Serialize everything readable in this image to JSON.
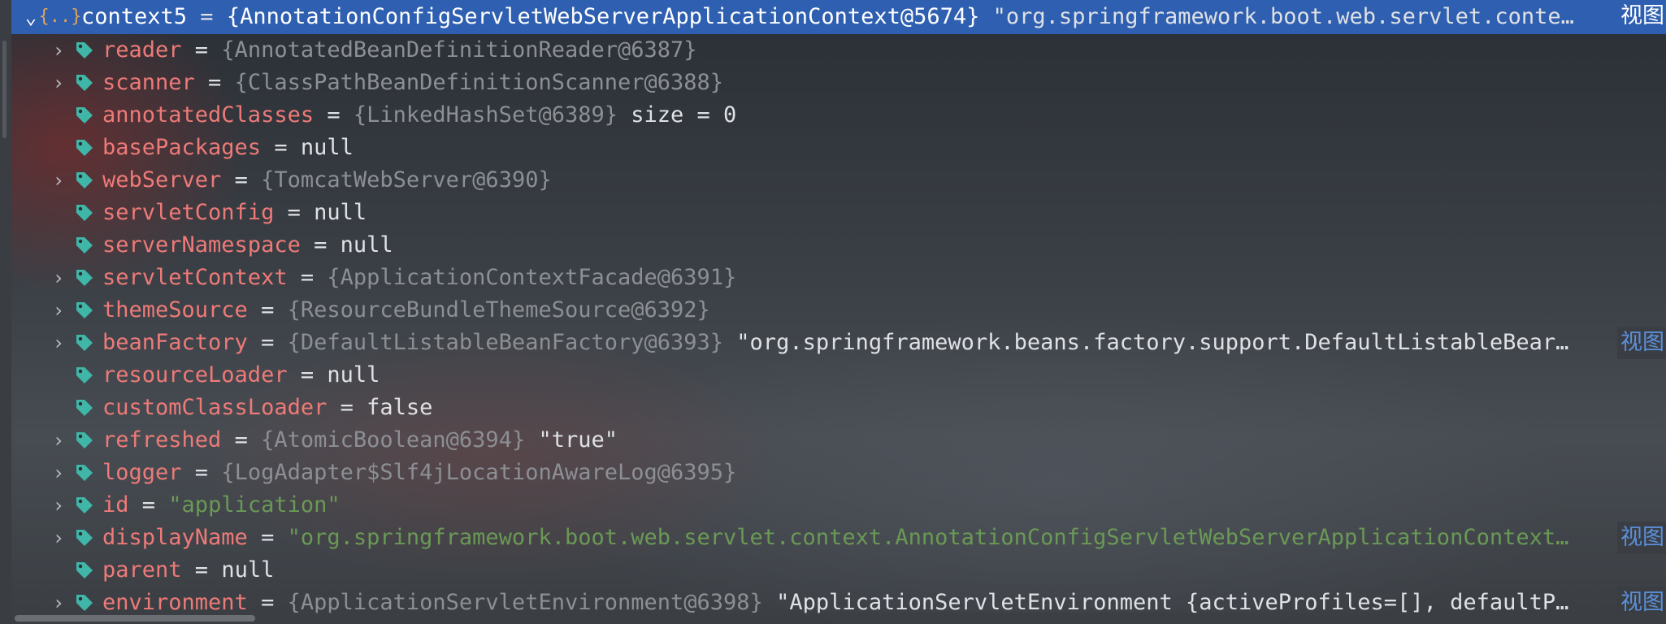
{
  "root": {
    "name": "context5",
    "type": "{AnnotationConfigServletWebServerApplicationContext@5674}",
    "value": "\"org.springframework.boot.web.servlet.conte…",
    "link": "视图"
  },
  "fields": [
    {
      "name": "reader",
      "type": "{AnnotatedBeanDefinitionReader@6387}",
      "expandable": true
    },
    {
      "name": "scanner",
      "type": "{ClassPathBeanDefinitionScanner@6388}",
      "expandable": true
    },
    {
      "name": "annotatedClasses",
      "type": "{LinkedHashSet@6389}",
      "extra": " size = 0",
      "expandable": false
    },
    {
      "name": "basePackages",
      "value": "null",
      "expandable": false
    },
    {
      "name": "webServer",
      "type": "{TomcatWebServer@6390}",
      "expandable": true
    },
    {
      "name": "servletConfig",
      "value": "null",
      "expandable": false
    },
    {
      "name": "serverNamespace",
      "value": "null",
      "expandable": false
    },
    {
      "name": "servletContext",
      "type": "{ApplicationContextFacade@6391}",
      "expandable": true
    },
    {
      "name": "themeSource",
      "type": "{ResourceBundleThemeSource@6392}",
      "expandable": true
    },
    {
      "name": "beanFactory",
      "type": "{DefaultListableBeanFactory@6393}",
      "extra": "\"org.springframework.beans.factory.support.DefaultListableBear…",
      "link": "视图",
      "expandable": true
    },
    {
      "name": "resourceLoader",
      "value": "null",
      "expandable": false
    },
    {
      "name": "customClassLoader",
      "value": "false",
      "expandable": false
    },
    {
      "name": "refreshed",
      "type": "{AtomicBoolean@6394}",
      "extra": "\"true\"",
      "expandable": true
    },
    {
      "name": "logger",
      "type": "{LogAdapter$Slf4jLocationAwareLog@6395}",
      "expandable": true
    },
    {
      "name": "id",
      "string": "\"application\"",
      "expandable": true
    },
    {
      "name": "displayName",
      "string": "\"org.springframework.boot.web.servlet.context.AnnotationConfigServletWebServerApplicationContext…",
      "link": "视图",
      "expandable": true
    },
    {
      "name": "parent",
      "value": "null",
      "expandable": false
    },
    {
      "name": "environment",
      "type": "{ApplicationServletEnvironment@6398}",
      "extra": "\"ApplicationServletEnvironment {activeProfiles=[], defaultP…",
      "link": "视图",
      "expandable": true
    }
  ],
  "icons": {
    "expanded": "chevron-down-icon",
    "collapsed": "chevron-right-icon",
    "field": "tag-icon",
    "object": "object-braces-icon"
  },
  "colors": {
    "selection": "#2e5fb0",
    "field_name": "#ee7a78",
    "type_ref": "#8c8f94",
    "string": "#6a9955",
    "link": "#5b8fd9",
    "tag_icon": "#3fb6a8"
  }
}
